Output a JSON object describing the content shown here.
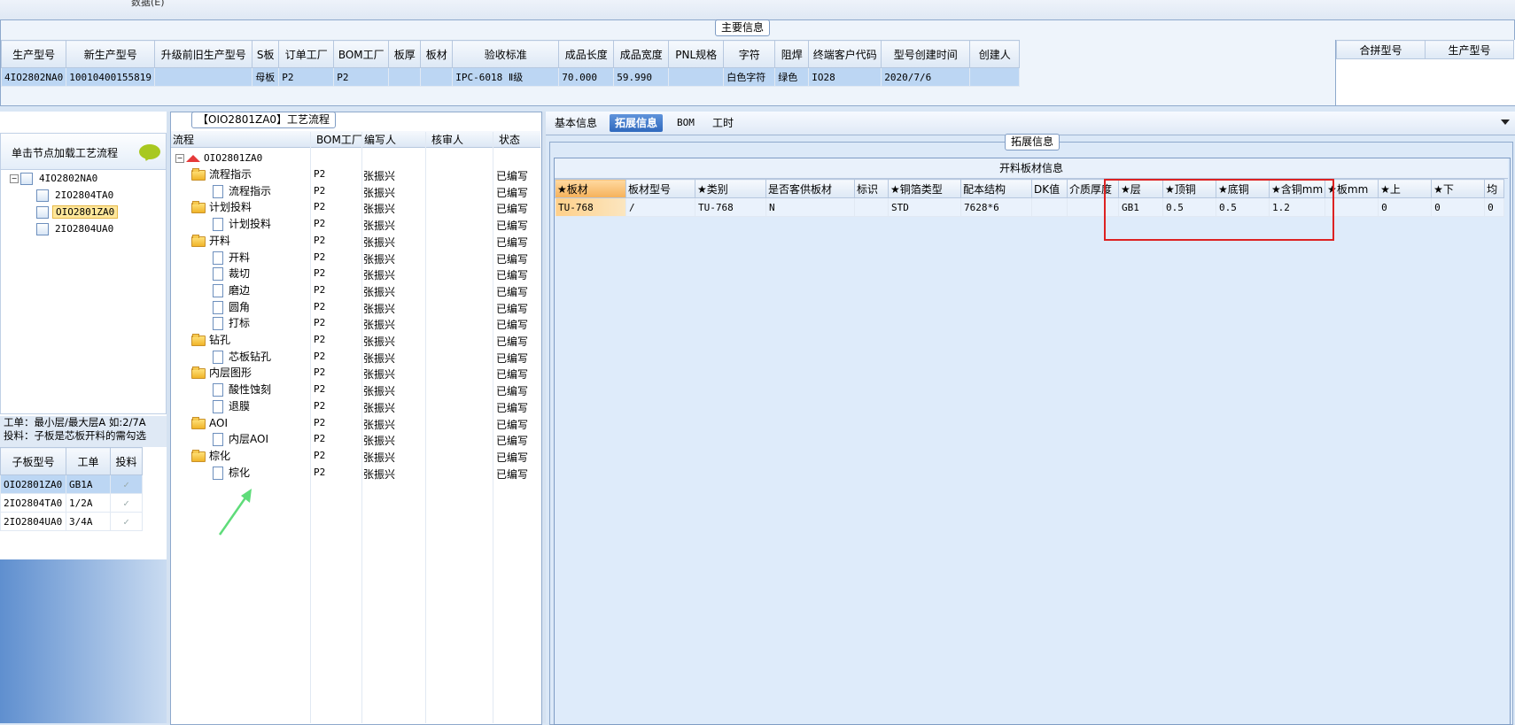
{
  "top_strip": {
    "text": "数据(E)"
  },
  "main_info": {
    "caption": "主要信息",
    "columns": [
      "生产型号",
      "新生产型号",
      "升级前旧生产型号",
      "S板",
      "订单工厂",
      "BOM工厂",
      "板厚",
      "板材",
      "验收标准",
      "成品长度",
      "成品宽度",
      "PNL规格",
      "字符",
      "阻焊",
      "终端客户代码",
      "型号创建时间",
      "创建人"
    ],
    "row": [
      "4IO2802NA0",
      "10010400155819",
      "",
      "母板",
      "P2",
      "P2",
      "",
      "",
      "IPC-6018 Ⅱ级",
      "70.000",
      "59.990",
      "",
      "白色字符",
      "绿色",
      "IO28",
      "2020/7/6",
      ""
    ],
    "side_columns": [
      "合拼型号",
      "生产型号"
    ]
  },
  "left_panel": {
    "load_hint": "单击节点加载工艺流程",
    "tree": [
      {
        "label": "4IO2802NA0"
      },
      {
        "label": "2IO2804TA0"
      },
      {
        "label": "OIO2801ZA0"
      },
      {
        "label": "2IO2804UA0"
      }
    ],
    "note_line1": "工单：最小层/最大层A 如:2/7A",
    "note_line2": "投料：子板是芯板开料的需勾选",
    "grid_columns": [
      "子板型号",
      "工单",
      "投料"
    ],
    "grid_rows": [
      {
        "model": "OIO2801ZA0",
        "order": "GB1A",
        "check": "✓"
      },
      {
        "model": "2IO2804TA0",
        "order": "1/2A",
        "check": "✓"
      },
      {
        "model": "2IO2804UA0",
        "order": "3/4A",
        "check": "✓"
      }
    ]
  },
  "process_panel": {
    "caption": "【OIO2801ZA0】工艺流程",
    "columns": [
      "流程",
      "BOM工厂",
      "编写人",
      "核审人",
      "状态"
    ],
    "root": "OIO2801ZA0",
    "rows": [
      {
        "name": "流程指示",
        "type": "folder",
        "bom": "P2",
        "author": "张振兴",
        "status": "已编写"
      },
      {
        "name": "流程指示",
        "type": "doc",
        "bom": "P2",
        "author": "张振兴",
        "status": "已编写"
      },
      {
        "name": "计划投料",
        "type": "folder",
        "bom": "P2",
        "author": "张振兴",
        "status": "已编写"
      },
      {
        "name": "计划投料",
        "type": "doc",
        "bom": "P2",
        "author": "张振兴",
        "status": "已编写"
      },
      {
        "name": "开料",
        "type": "folder",
        "bom": "P2",
        "author": "张振兴",
        "status": "已编写"
      },
      {
        "name": "开料",
        "type": "doc",
        "bom": "P2",
        "author": "张振兴",
        "status": "已编写"
      },
      {
        "name": "裁切",
        "type": "doc",
        "bom": "P2",
        "author": "张振兴",
        "status": "已编写"
      },
      {
        "name": "磨边",
        "type": "doc",
        "bom": "P2",
        "author": "张振兴",
        "status": "已编写"
      },
      {
        "name": "圆角",
        "type": "doc",
        "bom": "P2",
        "author": "张振兴",
        "status": "已编写"
      },
      {
        "name": "打标",
        "type": "doc",
        "bom": "P2",
        "author": "张振兴",
        "status": "已编写"
      },
      {
        "name": "钻孔",
        "type": "folder",
        "bom": "P2",
        "author": "张振兴",
        "status": "已编写"
      },
      {
        "name": "芯板钻孔",
        "type": "doc",
        "bom": "P2",
        "author": "张振兴",
        "status": "已编写"
      },
      {
        "name": "内层图形",
        "type": "folder",
        "bom": "P2",
        "author": "张振兴",
        "status": "已编写"
      },
      {
        "name": "酸性蚀刻",
        "type": "doc",
        "bom": "P2",
        "author": "张振兴",
        "status": "已编写"
      },
      {
        "name": "退膜",
        "type": "doc",
        "bom": "P2",
        "author": "张振兴",
        "status": "已编写"
      },
      {
        "name": "AOI",
        "type": "folder",
        "bom": "P2",
        "author": "张振兴",
        "status": "已编写"
      },
      {
        "name": "内层AOI",
        "type": "doc",
        "bom": "P2",
        "author": "张振兴",
        "status": "已编写"
      },
      {
        "name": "棕化",
        "type": "folder",
        "bom": "P2",
        "author": "张振兴",
        "status": "已编写"
      },
      {
        "name": "棕化",
        "type": "doc",
        "bom": "P2",
        "author": "张振兴",
        "status": "已编写"
      }
    ]
  },
  "tabs": [
    {
      "label": "基本信息",
      "active": false
    },
    {
      "label": "拓展信息",
      "active": true
    },
    {
      "label": "BOM",
      "active": false
    },
    {
      "label": "工时",
      "active": false
    }
  ],
  "ext_panel": {
    "caption": "拓展信息",
    "material_title": "开料板材信息",
    "columns": [
      "★板材",
      "板材型号",
      "★类别",
      "是否客供板材",
      "标识",
      "★铜箔类型",
      "配本结构",
      "DK值",
      "介质厚度",
      "★层",
      "★顶铜",
      "★底铜",
      "★含铜mm",
      "★板mm",
      "★上",
      "★下",
      "均"
    ],
    "row": [
      "TU-768",
      "/",
      "TU-768",
      "N",
      "",
      "STD",
      "7628*6",
      "",
      "",
      "GB1",
      "0.5",
      "0.5",
      "1.2",
      "",
      "0",
      "0",
      "0"
    ]
  }
}
